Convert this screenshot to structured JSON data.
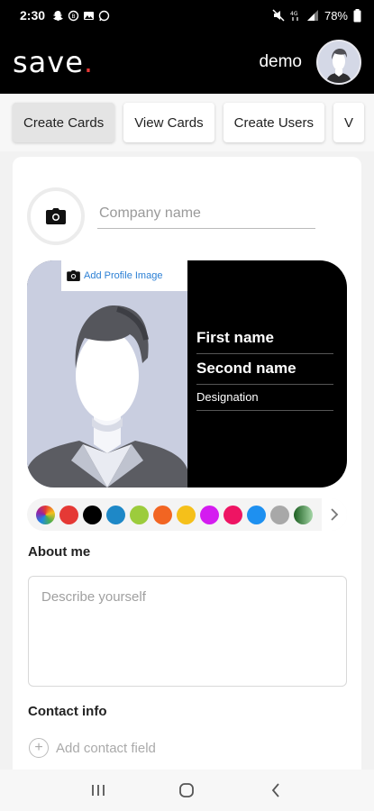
{
  "status_bar": {
    "time": "2:30",
    "battery": "78%",
    "left_icons": [
      "snapchat-icon",
      "whatsapp-business-icon",
      "gallery-icon",
      "whatsapp-icon"
    ],
    "right_icons": [
      "mute-icon",
      "data-4g-icon",
      "signal-icon",
      "battery-icon"
    ]
  },
  "app_bar": {
    "logo_text": "save",
    "logo_dot": ".",
    "logo_dot_color": "#e53935",
    "username": "demo"
  },
  "tabs": [
    {
      "label": "Create Cards",
      "active": true
    },
    {
      "label": "View Cards",
      "active": false
    },
    {
      "label": "Create Users",
      "active": false
    },
    {
      "label": "V",
      "active": false
    }
  ],
  "form": {
    "company_placeholder": "Company name",
    "add_profile_image": "Add Profile Image",
    "first_name": "First name",
    "second_name": "Second name",
    "designation": "Designation",
    "colors": [
      "gradient",
      "#e53935",
      "#000000",
      "#1e88c7",
      "#9ccc3c",
      "#f26522",
      "#f5c01a",
      "#d41cf0",
      "#ee1463",
      "#1e90f0",
      "#a8a8a8",
      "gradient-green"
    ],
    "about_title": "About me",
    "about_placeholder": "Describe yourself",
    "contact_title": "Contact info",
    "add_contact_label": "Add contact field"
  },
  "nav_bar": [
    "recents-icon",
    "home-icon",
    "back-icon"
  ]
}
